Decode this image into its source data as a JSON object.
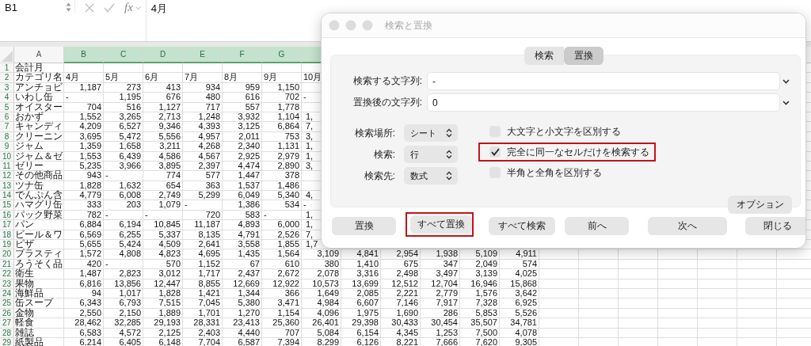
{
  "formula_bar": {
    "cell_ref": "B1",
    "function_label": "fx",
    "formula": "4月"
  },
  "sheet": {
    "columns": [
      {
        "label": "A",
        "selected": false
      },
      {
        "label": "B",
        "selected": true
      },
      {
        "label": "C",
        "selected": true
      },
      {
        "label": "D",
        "selected": true
      },
      {
        "label": "E",
        "selected": true
      },
      {
        "label": "F",
        "selected": true
      },
      {
        "label": "G",
        "selected": true
      },
      {
        "selected": true
      }
    ],
    "rows": [
      {
        "number": "1",
        "cells": [
          {
            "text": "会計月",
            "kind": "label"
          }
        ]
      },
      {
        "number": "2",
        "cells": [
          {
            "text": "カテゴリ名",
            "kind": "label"
          },
          {
            "text": "4月",
            "kind": "label"
          },
          {
            "text": "5月",
            "kind": "label"
          },
          {
            "text": "6月",
            "kind": "label"
          },
          {
            "text": "7月",
            "kind": "label"
          },
          {
            "text": "8月",
            "kind": "label"
          },
          {
            "text": "9月",
            "kind": "label"
          },
          {
            "text": "10月",
            "kind": "label"
          }
        ]
      },
      {
        "number": "3",
        "cells": [
          {
            "text": "アンチョビ",
            "kind": "label"
          },
          {
            "text": "1,187",
            "kind": "num"
          },
          {
            "text": "273",
            "kind": "num"
          },
          {
            "text": "413",
            "kind": "num"
          },
          {
            "text": "934",
            "kind": "num"
          },
          {
            "text": "959",
            "kind": "num"
          },
          {
            "text": "1,150",
            "kind": "num"
          }
        ]
      },
      {
        "number": "4",
        "cells": [
          {
            "text": "いわし缶",
            "kind": "label"
          },
          {
            "text": "-",
            "kind": "label"
          },
          {
            "text": "1,195",
            "kind": "num"
          },
          {
            "text": "676",
            "kind": "num"
          },
          {
            "text": "480",
            "kind": "num"
          },
          {
            "text": "616",
            "kind": "num"
          },
          {
            "text": "702",
            "kind": "num"
          },
          {
            "text": "-",
            "kind": "label"
          }
        ]
      },
      {
        "number": "5",
        "cells": [
          {
            "text": "オイスター",
            "kind": "label"
          },
          {
            "text": "704",
            "kind": "num"
          },
          {
            "text": "516",
            "kind": "num"
          },
          {
            "text": "1,127",
            "kind": "num"
          },
          {
            "text": "717",
            "kind": "num"
          },
          {
            "text": "557",
            "kind": "num"
          },
          {
            "text": "1,778",
            "kind": "num"
          }
        ]
      },
      {
        "number": "6",
        "cells": [
          {
            "text": "おかず",
            "kind": "label"
          },
          {
            "text": "1,552",
            "kind": "num"
          },
          {
            "text": "3,265",
            "kind": "num"
          },
          {
            "text": "2,713",
            "kind": "num"
          },
          {
            "text": "1,248",
            "kind": "num"
          },
          {
            "text": "3,932",
            "kind": "num"
          },
          {
            "text": "1,104",
            "kind": "num"
          },
          {
            "text": "1,",
            "kind": "cut"
          }
        ]
      },
      {
        "number": "7",
        "cells": [
          {
            "text": "キャンディ",
            "kind": "label"
          },
          {
            "text": "4,209",
            "kind": "num"
          },
          {
            "text": "6,527",
            "kind": "num"
          },
          {
            "text": "9,346",
            "kind": "num"
          },
          {
            "text": "4,393",
            "kind": "num"
          },
          {
            "text": "3,125",
            "kind": "num"
          },
          {
            "text": "6,864",
            "kind": "num"
          },
          {
            "text": "7,",
            "kind": "cut"
          }
        ]
      },
      {
        "number": "8",
        "cells": [
          {
            "text": "クリーニン",
            "kind": "label"
          },
          {
            "text": "3,695",
            "kind": "num"
          },
          {
            "text": "5,472",
            "kind": "num"
          },
          {
            "text": "5,556",
            "kind": "num"
          },
          {
            "text": "4,957",
            "kind": "num"
          },
          {
            "text": "2,011",
            "kind": "num"
          },
          {
            "text": "753",
            "kind": "num"
          },
          {
            "text": "3,",
            "kind": "cut"
          }
        ]
      },
      {
        "number": "9",
        "cells": [
          {
            "text": "ジャム",
            "kind": "label"
          },
          {
            "text": "1,359",
            "kind": "num"
          },
          {
            "text": "1,658",
            "kind": "num"
          },
          {
            "text": "3,211",
            "kind": "num"
          },
          {
            "text": "4,268",
            "kind": "num"
          },
          {
            "text": "2,340",
            "kind": "num"
          },
          {
            "text": "1,131",
            "kind": "num"
          },
          {
            "text": "1,",
            "kind": "cut"
          }
        ]
      },
      {
        "number": "10",
        "cells": [
          {
            "text": "ジャム＆ゼ",
            "kind": "label"
          },
          {
            "text": "1,553",
            "kind": "num"
          },
          {
            "text": "6,439",
            "kind": "num"
          },
          {
            "text": "4,586",
            "kind": "num"
          },
          {
            "text": "4,567",
            "kind": "num"
          },
          {
            "text": "2,925",
            "kind": "num"
          },
          {
            "text": "2,979",
            "kind": "num"
          },
          {
            "text": "1,",
            "kind": "cut"
          }
        ]
      },
      {
        "number": "11",
        "cells": [
          {
            "text": "ゼリー",
            "kind": "label"
          },
          {
            "text": "5,235",
            "kind": "num"
          },
          {
            "text": "3,966",
            "kind": "num"
          },
          {
            "text": "3,895",
            "kind": "num"
          },
          {
            "text": "2,397",
            "kind": "num"
          },
          {
            "text": "4,474",
            "kind": "num"
          },
          {
            "text": "2,890",
            "kind": "num"
          },
          {
            "text": "3,",
            "kind": "cut"
          }
        ]
      },
      {
        "number": "12",
        "cells": [
          {
            "text": "その他商品",
            "kind": "label"
          },
          {
            "text": "943",
            "kind": "num"
          },
          {
            "text": "-",
            "kind": "label"
          },
          {
            "text": "774",
            "kind": "num"
          },
          {
            "text": "577",
            "kind": "num"
          },
          {
            "text": "1,447",
            "kind": "num"
          },
          {
            "text": "378",
            "kind": "num"
          }
        ]
      },
      {
        "number": "13",
        "cells": [
          {
            "text": "ツナ缶",
            "kind": "label"
          },
          {
            "text": "1,828",
            "kind": "num"
          },
          {
            "text": "1,632",
            "kind": "num"
          },
          {
            "text": "654",
            "kind": "num"
          },
          {
            "text": "363",
            "kind": "num"
          },
          {
            "text": "1,537",
            "kind": "num"
          },
          {
            "text": "1,486",
            "kind": "num"
          }
        ]
      },
      {
        "number": "14",
        "cells": [
          {
            "text": "でんぷん含",
            "kind": "label"
          },
          {
            "text": "4,779",
            "kind": "num"
          },
          {
            "text": "6,008",
            "kind": "num"
          },
          {
            "text": "2,749",
            "kind": "num"
          },
          {
            "text": "5,299",
            "kind": "num"
          },
          {
            "text": "6,049",
            "kind": "num"
          },
          {
            "text": "5,340",
            "kind": "num"
          },
          {
            "text": "4,",
            "kind": "cut"
          }
        ]
      },
      {
        "number": "15",
        "cells": [
          {
            "text": "ハマグリ缶",
            "kind": "label"
          },
          {
            "text": "333",
            "kind": "num"
          },
          {
            "text": "203",
            "kind": "num"
          },
          {
            "text": "1,079",
            "kind": "num"
          },
          {
            "text": "-",
            "kind": "label"
          },
          {
            "text": "1,386",
            "kind": "num"
          },
          {
            "text": "534",
            "kind": "num"
          },
          {
            "text": "-",
            "kind": "label"
          }
        ]
      },
      {
        "number": "16",
        "cells": [
          {
            "text": "パック野菜",
            "kind": "label"
          },
          {
            "text": "782",
            "kind": "num"
          },
          {
            "text": "-",
            "kind": "label"
          },
          {
            "text": "-",
            "kind": "label"
          },
          {
            "text": "720",
            "kind": "num"
          },
          {
            "text": "583",
            "kind": "num"
          },
          {
            "text": "-",
            "kind": "label"
          },
          {
            "text": "1,",
            "kind": "cut"
          }
        ]
      },
      {
        "number": "17",
        "cells": [
          {
            "text": "パン",
            "kind": "label"
          },
          {
            "text": "6,884",
            "kind": "num"
          },
          {
            "text": "6,194",
            "kind": "num"
          },
          {
            "text": "10,845",
            "kind": "num"
          },
          {
            "text": "11,187",
            "kind": "num"
          },
          {
            "text": "4,893",
            "kind": "num"
          },
          {
            "text": "6,000",
            "kind": "num"
          },
          {
            "text": "1,",
            "kind": "cut"
          }
        ]
      },
      {
        "number": "18",
        "cells": [
          {
            "text": "ビール＆ワ",
            "kind": "label"
          },
          {
            "text": "6,569",
            "kind": "num"
          },
          {
            "text": "6,255",
            "kind": "num"
          },
          {
            "text": "5,337",
            "kind": "num"
          },
          {
            "text": "8,135",
            "kind": "num"
          },
          {
            "text": "4,791",
            "kind": "num"
          },
          {
            "text": "2,526",
            "kind": "num"
          },
          {
            "text": "7,",
            "kind": "cut"
          }
        ]
      },
      {
        "number": "19",
        "cells": [
          {
            "text": "ピザ",
            "kind": "label"
          },
          {
            "text": "5,655",
            "kind": "num"
          },
          {
            "text": "5,424",
            "kind": "num"
          },
          {
            "text": "4,509",
            "kind": "num"
          },
          {
            "text": "2,641",
            "kind": "num"
          },
          {
            "text": "3,558",
            "kind": "num"
          },
          {
            "text": "1,855",
            "kind": "num"
          },
          {
            "text": "1,7",
            "kind": "cut"
          }
        ]
      },
      {
        "number": "20",
        "cells": [
          {
            "text": "プラスティ",
            "kind": "label"
          },
          {
            "text": "1,572",
            "kind": "num"
          },
          {
            "text": "4,808",
            "kind": "num"
          },
          {
            "text": "4,823",
            "kind": "num"
          },
          {
            "text": "4,695",
            "kind": "num"
          },
          {
            "text": "1,435",
            "kind": "num"
          },
          {
            "text": "1,564",
            "kind": "num"
          },
          {
            "text": "3,109",
            "kind": "num"
          },
          {
            "text": "4,841",
            "kind": "num"
          },
          {
            "text": "2,954",
            "kind": "num"
          },
          {
            "text": "1,938",
            "kind": "num"
          },
          {
            "text": "5,109",
            "kind": "num"
          },
          {
            "text": "4,911",
            "kind": "num"
          }
        ]
      },
      {
        "number": "21",
        "cells": [
          {
            "text": "ろうそく品",
            "kind": "label"
          },
          {
            "text": "420",
            "kind": "num"
          },
          {
            "text": "-",
            "kind": "label"
          },
          {
            "text": "570",
            "kind": "num"
          },
          {
            "text": "1,152",
            "kind": "num"
          },
          {
            "text": "67",
            "kind": "num"
          },
          {
            "text": "610",
            "kind": "num"
          },
          {
            "text": "380",
            "kind": "num"
          },
          {
            "text": "1,410",
            "kind": "num"
          },
          {
            "text": "675",
            "kind": "num"
          },
          {
            "text": "347",
            "kind": "num"
          },
          {
            "text": "2,049",
            "kind": "num"
          },
          {
            "text": "574",
            "kind": "num"
          }
        ]
      },
      {
        "number": "22",
        "cells": [
          {
            "text": "衛生",
            "kind": "label"
          },
          {
            "text": "1,487",
            "kind": "num"
          },
          {
            "text": "2,823",
            "kind": "num"
          },
          {
            "text": "3,012",
            "kind": "num"
          },
          {
            "text": "1,717",
            "kind": "num"
          },
          {
            "text": "2,437",
            "kind": "num"
          },
          {
            "text": "2,672",
            "kind": "num"
          },
          {
            "text": "2,078",
            "kind": "num"
          },
          {
            "text": "3,316",
            "kind": "num"
          },
          {
            "text": "2,498",
            "kind": "num"
          },
          {
            "text": "3,497",
            "kind": "num"
          },
          {
            "text": "3,139",
            "kind": "num"
          },
          {
            "text": "4,025",
            "kind": "num"
          }
        ]
      },
      {
        "number": "23",
        "cells": [
          {
            "text": "果物",
            "kind": "label"
          },
          {
            "text": "6,816",
            "kind": "num"
          },
          {
            "text": "13,856",
            "kind": "num"
          },
          {
            "text": "12,447",
            "kind": "num"
          },
          {
            "text": "8,855",
            "kind": "num"
          },
          {
            "text": "12,669",
            "kind": "num"
          },
          {
            "text": "12,922",
            "kind": "num"
          },
          {
            "text": "10,573",
            "kind": "num"
          },
          {
            "text": "13,699",
            "kind": "num"
          },
          {
            "text": "12,512",
            "kind": "num"
          },
          {
            "text": "12,704",
            "kind": "num"
          },
          {
            "text": "16,946",
            "kind": "num"
          },
          {
            "text": "15,868",
            "kind": "num"
          }
        ]
      },
      {
        "number": "24",
        "cells": [
          {
            "text": "海鮮品",
            "kind": "label"
          },
          {
            "text": "94",
            "kind": "num"
          },
          {
            "text": "1,017",
            "kind": "num"
          },
          {
            "text": "1,828",
            "kind": "num"
          },
          {
            "text": "1,421",
            "kind": "num"
          },
          {
            "text": "1,344",
            "kind": "num"
          },
          {
            "text": "366",
            "kind": "num"
          },
          {
            "text": "1,649",
            "kind": "num"
          },
          {
            "text": "2,085",
            "kind": "num"
          },
          {
            "text": "2,221",
            "kind": "num"
          },
          {
            "text": "2,779",
            "kind": "num"
          },
          {
            "text": "1,576",
            "kind": "num"
          },
          {
            "text": "3,642",
            "kind": "num"
          }
        ]
      },
      {
        "number": "25",
        "cells": [
          {
            "text": "缶スープ",
            "kind": "label"
          },
          {
            "text": "6,343",
            "kind": "num"
          },
          {
            "text": "6,793",
            "kind": "num"
          },
          {
            "text": "7,515",
            "kind": "num"
          },
          {
            "text": "7,045",
            "kind": "num"
          },
          {
            "text": "5,380",
            "kind": "num"
          },
          {
            "text": "3,471",
            "kind": "num"
          },
          {
            "text": "4,984",
            "kind": "num"
          },
          {
            "text": "6,607",
            "kind": "num"
          },
          {
            "text": "7,146",
            "kind": "num"
          },
          {
            "text": "7,917",
            "kind": "num"
          },
          {
            "text": "7,328",
            "kind": "num"
          },
          {
            "text": "6,925",
            "kind": "num"
          }
        ]
      },
      {
        "number": "26",
        "cells": [
          {
            "text": "金物",
            "kind": "label"
          },
          {
            "text": "2,550",
            "kind": "num"
          },
          {
            "text": "2,150",
            "kind": "num"
          },
          {
            "text": "1,889",
            "kind": "num"
          },
          {
            "text": "1,701",
            "kind": "num"
          },
          {
            "text": "1,270",
            "kind": "num"
          },
          {
            "text": "1,154",
            "kind": "num"
          },
          {
            "text": "4,096",
            "kind": "num"
          },
          {
            "text": "1,975",
            "kind": "num"
          },
          {
            "text": "1,690",
            "kind": "num"
          },
          {
            "text": "286",
            "kind": "num"
          },
          {
            "text": "5,853",
            "kind": "num"
          },
          {
            "text": "5,526",
            "kind": "num"
          }
        ]
      },
      {
        "number": "27",
        "cells": [
          {
            "text": "軽食",
            "kind": "label"
          },
          {
            "text": "28,462",
            "kind": "num"
          },
          {
            "text": "32,285",
            "kind": "num"
          },
          {
            "text": "29,193",
            "kind": "num"
          },
          {
            "text": "28,331",
            "kind": "num"
          },
          {
            "text": "23,413",
            "kind": "num"
          },
          {
            "text": "25,360",
            "kind": "num"
          },
          {
            "text": "26,401",
            "kind": "num"
          },
          {
            "text": "29,398",
            "kind": "num"
          },
          {
            "text": "30,433",
            "kind": "num"
          },
          {
            "text": "30,454",
            "kind": "num"
          },
          {
            "text": "35,507",
            "kind": "num"
          },
          {
            "text": "34,781",
            "kind": "num"
          }
        ]
      },
      {
        "number": "28",
        "cells": [
          {
            "text": "雑誌",
            "kind": "label"
          },
          {
            "text": "6,583",
            "kind": "num"
          },
          {
            "text": "4,572",
            "kind": "num"
          },
          {
            "text": "2,125",
            "kind": "num"
          },
          {
            "text": "2,403",
            "kind": "num"
          },
          {
            "text": "4,440",
            "kind": "num"
          },
          {
            "text": "707",
            "kind": "num"
          },
          {
            "text": "5,084",
            "kind": "num"
          },
          {
            "text": "6,154",
            "kind": "num"
          },
          {
            "text": "4,345",
            "kind": "num"
          },
          {
            "text": "1,253",
            "kind": "num"
          },
          {
            "text": "7,500",
            "kind": "num"
          },
          {
            "text": "4,078",
            "kind": "num"
          }
        ]
      },
      {
        "number": "29",
        "cells": [
          {
            "text": "紙製品",
            "kind": "label"
          },
          {
            "text": "6,214",
            "kind": "num"
          },
          {
            "text": "6,405",
            "kind": "num"
          },
          {
            "text": "6,148",
            "kind": "num"
          },
          {
            "text": "7,704",
            "kind": "num"
          },
          {
            "text": "6,587",
            "kind": "num"
          },
          {
            "text": "7,394",
            "kind": "num"
          },
          {
            "text": "8,299",
            "kind": "num"
          },
          {
            "text": "6,126",
            "kind": "num"
          },
          {
            "text": "8,221",
            "kind": "num"
          },
          {
            "text": "7,666",
            "kind": "num"
          },
          {
            "text": "7,620",
            "kind": "num"
          },
          {
            "text": "9,305",
            "kind": "num"
          }
        ]
      }
    ]
  },
  "dialog": {
    "title": "検索と置換",
    "tabs": [
      {
        "label": "検索",
        "selected": false
      },
      {
        "label": "置換",
        "selected": true
      }
    ],
    "fields": [
      {
        "label": "検索する文字列:",
        "value": "-"
      },
      {
        "label": "置換後の文字列:",
        "value": "0"
      }
    ],
    "selects": [
      {
        "label": "検索場所:",
        "value": "シート"
      },
      {
        "label": "検索:",
        "value": "行"
      },
      {
        "label": "検索先:",
        "value": "数式"
      }
    ],
    "checkboxes": [
      {
        "label": "大文字と小文字を区別する",
        "checked": false,
        "highlighted": false
      },
      {
        "label": "完全に同一なセルだけを検索する",
        "checked": true,
        "highlighted": true
      },
      {
        "label": "半角と全角を区別する",
        "checked": false,
        "highlighted": false
      }
    ],
    "options_button": "オプション",
    "buttons": [
      {
        "label": "置換",
        "highlighted": false
      },
      {
        "label": "すべて置換",
        "highlighted": true
      },
      {
        "label": "すべて検索",
        "highlighted": false
      },
      {
        "label": "前へ",
        "highlighted": false
      },
      {
        "label": "次へ",
        "highlighted": false
      },
      {
        "label": "閉じる",
        "highlighted": false
      }
    ]
  }
}
